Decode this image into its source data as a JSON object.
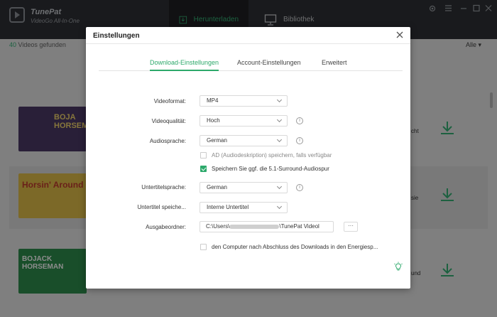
{
  "app": {
    "name": "TunePat",
    "subtitle": "VideoGo All-In-One",
    "tabs": {
      "download": "Herunterladen",
      "library": "Bibliothek"
    },
    "colors": {
      "accent": "#35b176",
      "titlebar": "#2f3136"
    }
  },
  "main": {
    "found_count": "40",
    "found_text": "Videos gefunden",
    "filter_label": "Alle",
    "videos": [
      {
        "thumb_text": "BOJA HORSEM",
        "side_text": "cht"
      },
      {
        "thumb_text": "Horsin' Around",
        "side_text": "sie"
      },
      {
        "thumb_text": "BOJACK HORSEMAN",
        "side_text": "und"
      }
    ]
  },
  "dialog": {
    "title": "Einstellungen",
    "tabs": [
      "Download-Einstellungen",
      "Account-Einstellungen",
      "Erweitert"
    ],
    "active_tab": "Download-Einstellungen",
    "fields": {
      "videoformat": {
        "label": "Videoformat:",
        "value": "MP4"
      },
      "videoqualitaet": {
        "label": "Videoqualität:",
        "value": "Hoch"
      },
      "audiosprache": {
        "label": "Audiosprache:",
        "value": "German"
      },
      "untertitelsprache": {
        "label": "Untertitelsprache:",
        "value": "German"
      },
      "untertitel_speichern": {
        "label": "Untertitel speiche...",
        "value": "Interne Untertitel"
      },
      "ausgabeordner": {
        "label": "Ausgabeordner:",
        "value_prefix": "C:\\Users\\",
        "value_suffix": "\\TunePat Videol",
        "more": "···"
      }
    },
    "checkboxes": {
      "ad": {
        "label": "AD (Audiodeskription) speichern, falls verfügbar",
        "checked": false
      },
      "surround": {
        "label": "Speichern Sie ggf. die 5.1-Surround-Audiospur",
        "checked": true
      },
      "energy": {
        "label": "den Computer nach Abschluss des Downloads in den Energiesp...",
        "checked": false
      }
    },
    "info_glyph": "i"
  }
}
